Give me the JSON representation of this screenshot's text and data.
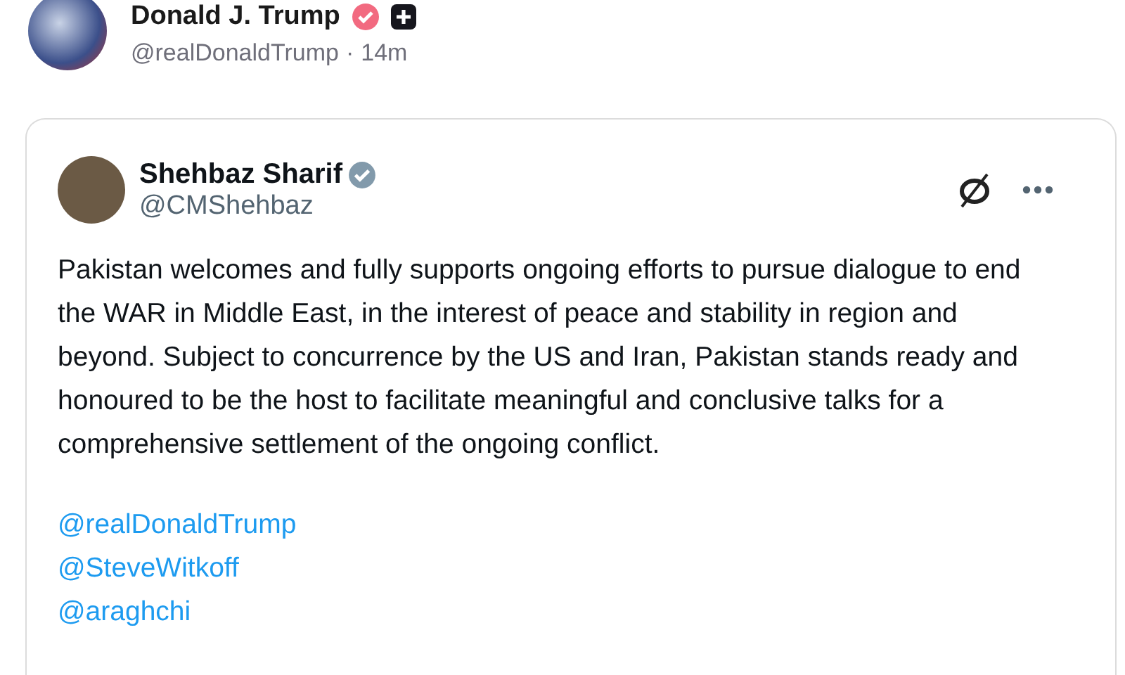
{
  "post": {
    "author": "Donald J. Trump",
    "handle": "@realDonaldTrump",
    "separator": "·",
    "time": "14m",
    "verified": true
  },
  "quoted_post": {
    "author": "Shehbaz Sharif",
    "handle": "@CMShehbaz",
    "verified": true,
    "text": "Pakistan welcomes and fully supports ongoing efforts to pursue dialogue to end the WAR in Middle East, in the interest of peace and stability in region and beyond. Subject to concurrence by the US and Iran, Pakistan stands ready and honoured to be the host to facilitate meaningful and conclusive talks for a comprehensive settlement of the ongoing conflict.",
    "mentions": [
      "@realDonaldTrump",
      "@SteveWitkoff",
      "@araghchi"
    ]
  }
}
